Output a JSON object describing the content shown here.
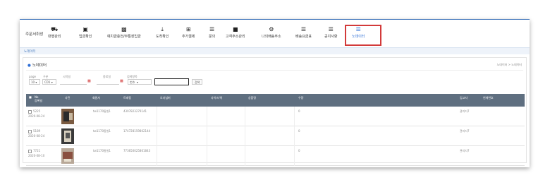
{
  "topbar": {
    "order_label": "주문서취성",
    "nav": [
      {
        "label": "대행관리",
        "icon": "truck-icon"
      },
      {
        "label": "입금확인",
        "icon": "money-icon"
      },
      {
        "label": "예치금충전/무통장입금",
        "icon": "document-icon"
      },
      {
        "label": "도착확인",
        "icon": "download-icon"
      },
      {
        "label": "추가결제",
        "icon": "plus-square-icon"
      },
      {
        "label": "문의",
        "icon": "list-icon"
      },
      {
        "label": "고객주소관리",
        "icon": "address-book-icon"
      },
      {
        "label": "나의배송주소",
        "icon": "gears-icon"
      },
      {
        "label": "배송요금표",
        "icon": "list-icon"
      },
      {
        "label": "공지사항",
        "icon": "list-icon"
      },
      {
        "label": "노데이터",
        "icon": "list-icon"
      }
    ]
  },
  "breadcrumb": "노데이터",
  "panel": {
    "title": "노데이터",
    "crumb_right": "노데이터 > 노데이터"
  },
  "filters": {
    "page_label": "page",
    "page_value": "10",
    "type_label": "구분",
    "type_value": "CD1",
    "start_label": "시작일",
    "end_label": "종료일",
    "search_label": "검색항목",
    "search_field_value": "번호",
    "search_button": "검색"
  },
  "table": {
    "headers": [
      "No\n등록일",
      "사진",
      "회원사",
      "트래킹",
      "오더넘버",
      "사이즈/색",
      "상품명",
      "수량",
      "입고자",
      "연계번호"
    ],
    "rows": [
      {
        "no": "5225",
        "date": "2020-08-24",
        "member": "tw1170통빌1",
        "tracking": "4307823279141",
        "qty": "0",
        "receiver": "관리자7"
      },
      {
        "no": "5189",
        "date": "2020-08-24",
        "member": "tw1170통빌1",
        "tracking": "174728159802144",
        "qty": "0",
        "receiver": "관리자7"
      },
      {
        "no": "7721",
        "date": "2020-08-10",
        "member": "tw1170통빌1",
        "tracking": "773650025861843",
        "qty": "0",
        "receiver": "관리자7"
      }
    ]
  },
  "colors": {
    "accent": "#2f6fd6",
    "header_bg": "#5f6f80",
    "highlight": "#d23a3a"
  }
}
